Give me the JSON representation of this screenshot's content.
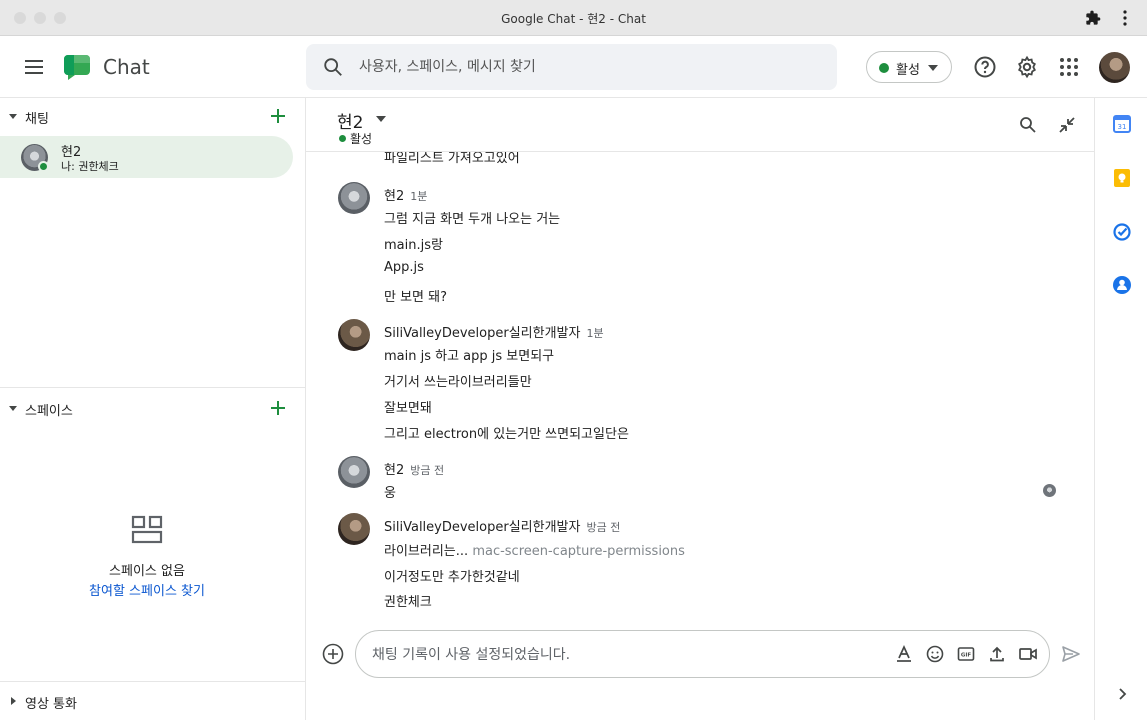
{
  "window": {
    "title": "Google Chat - 현2 - Chat"
  },
  "header": {
    "brand": "Chat",
    "search_placeholder": "사용자, 스페이스, 메시지 찾기",
    "status_label": "활성"
  },
  "sidebar": {
    "chats_label": "채팅",
    "dm": {
      "name": "현2",
      "preview": "나: 권한체크"
    },
    "spaces_label": "스페이스",
    "spaces_empty": "스페이스 없음",
    "spaces_find": "참여할 스페이스 찾기",
    "video_label": "영상 통화"
  },
  "conversation": {
    "title": "현2",
    "status": "활성",
    "messages": [
      {
        "text": "파일리스트 가져오고있어"
      },
      {
        "sender": "현2",
        "time": "1분",
        "lines": [
          "그럼 지금 화면 두개 나오는 거는",
          "main.js랑",
          "App.js",
          "만 보면 돼?"
        ]
      },
      {
        "sender": "SiliValleyDeveloper실리한개발자",
        "time": "1분",
        "lines": [
          "main js 하고 app js 보면되구",
          "거기서 쓰는라이브러리들만",
          "잘보면돼",
          "그리고 electron에 있는거만 쓰면되고일단은"
        ]
      },
      {
        "sender": "현2",
        "time": "방금 전",
        "lines": [
          "웅"
        ]
      },
      {
        "sender": "SiliValleyDeveloper실리한개발자",
        "time": "방금 전",
        "lines": [
          "라이브러리는...",
          "이거정도만 추가한것같네",
          "권한체크"
        ],
        "link": "mac-screen-capture-permissions"
      }
    ],
    "composer_placeholder": "채팅 기록이 사용 설정되었습니다."
  },
  "colors": {
    "accent_green": "#1e8e3e",
    "link_blue": "#0b57d0",
    "selected_bg": "#e7f1e8"
  }
}
